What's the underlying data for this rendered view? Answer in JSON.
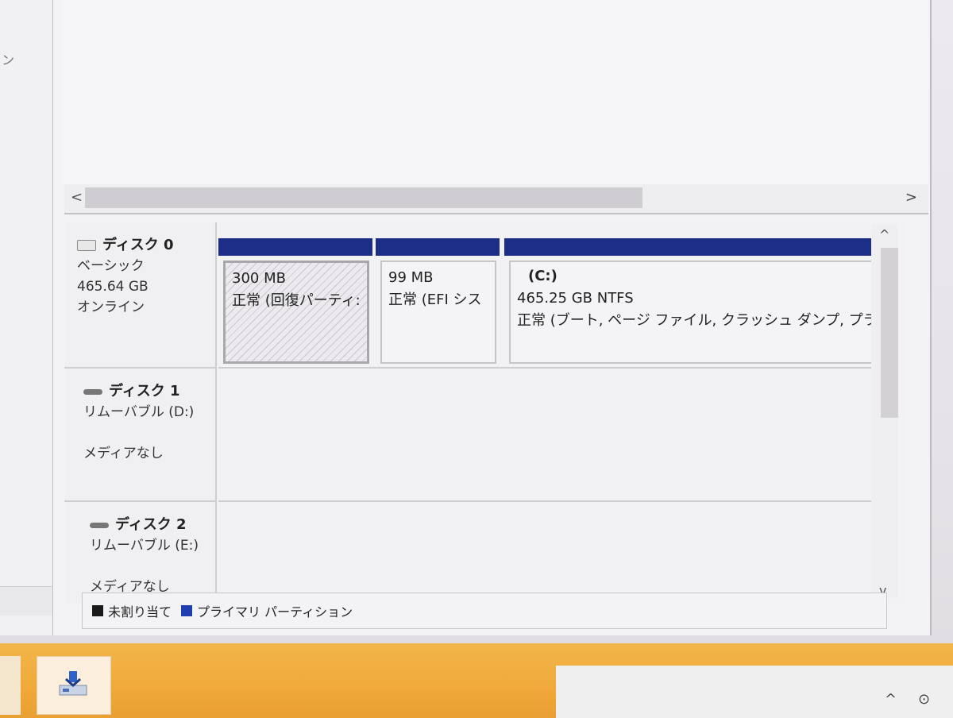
{
  "scroll": {
    "left_arrow": "<",
    "right_arrow": ">",
    "up_arrow": "^",
    "down_arrow": "v",
    "nav_arrow": ">"
  },
  "disks": [
    {
      "name": "ディスク 0",
      "type": "ベーシック",
      "size": "465.64 GB",
      "status": "オンライン",
      "icon": "disk-icon",
      "partitions": [
        {
          "title": "",
          "size": "300 MB",
          "status": "正常 (回復パーティ:"
        },
        {
          "title": "",
          "size": "99 MB",
          "status": "正常 (EFI シス"
        },
        {
          "title": "(C:)",
          "size": "465.25 GB NTFS",
          "status": "正常 (ブート, ページ ファイル, クラッシュ ダンプ, プラ-"
        }
      ]
    },
    {
      "name": "ディスク 1",
      "type": "リムーバブル (D:)",
      "size": "",
      "status": "メディアなし",
      "icon": "removable-disk-icon"
    },
    {
      "name": "ディスク 2",
      "type": "リムーバブル (E:)",
      "size": "",
      "status": "メディアなし",
      "icon": "removable-disk-icon"
    }
  ],
  "legend": {
    "unallocated": "未割り当て",
    "primary": "プライマリ パーティション"
  },
  "colors": {
    "partition_header": "#1c2e86",
    "unallocated": "#1a1a1a",
    "primary": "#1f3fb0",
    "taskbar": "#f0a93a"
  },
  "taskbar": {
    "app_icon": "disk-management-icon",
    "tray_icons": [
      "chevron-up-icon",
      "network-icon"
    ]
  }
}
